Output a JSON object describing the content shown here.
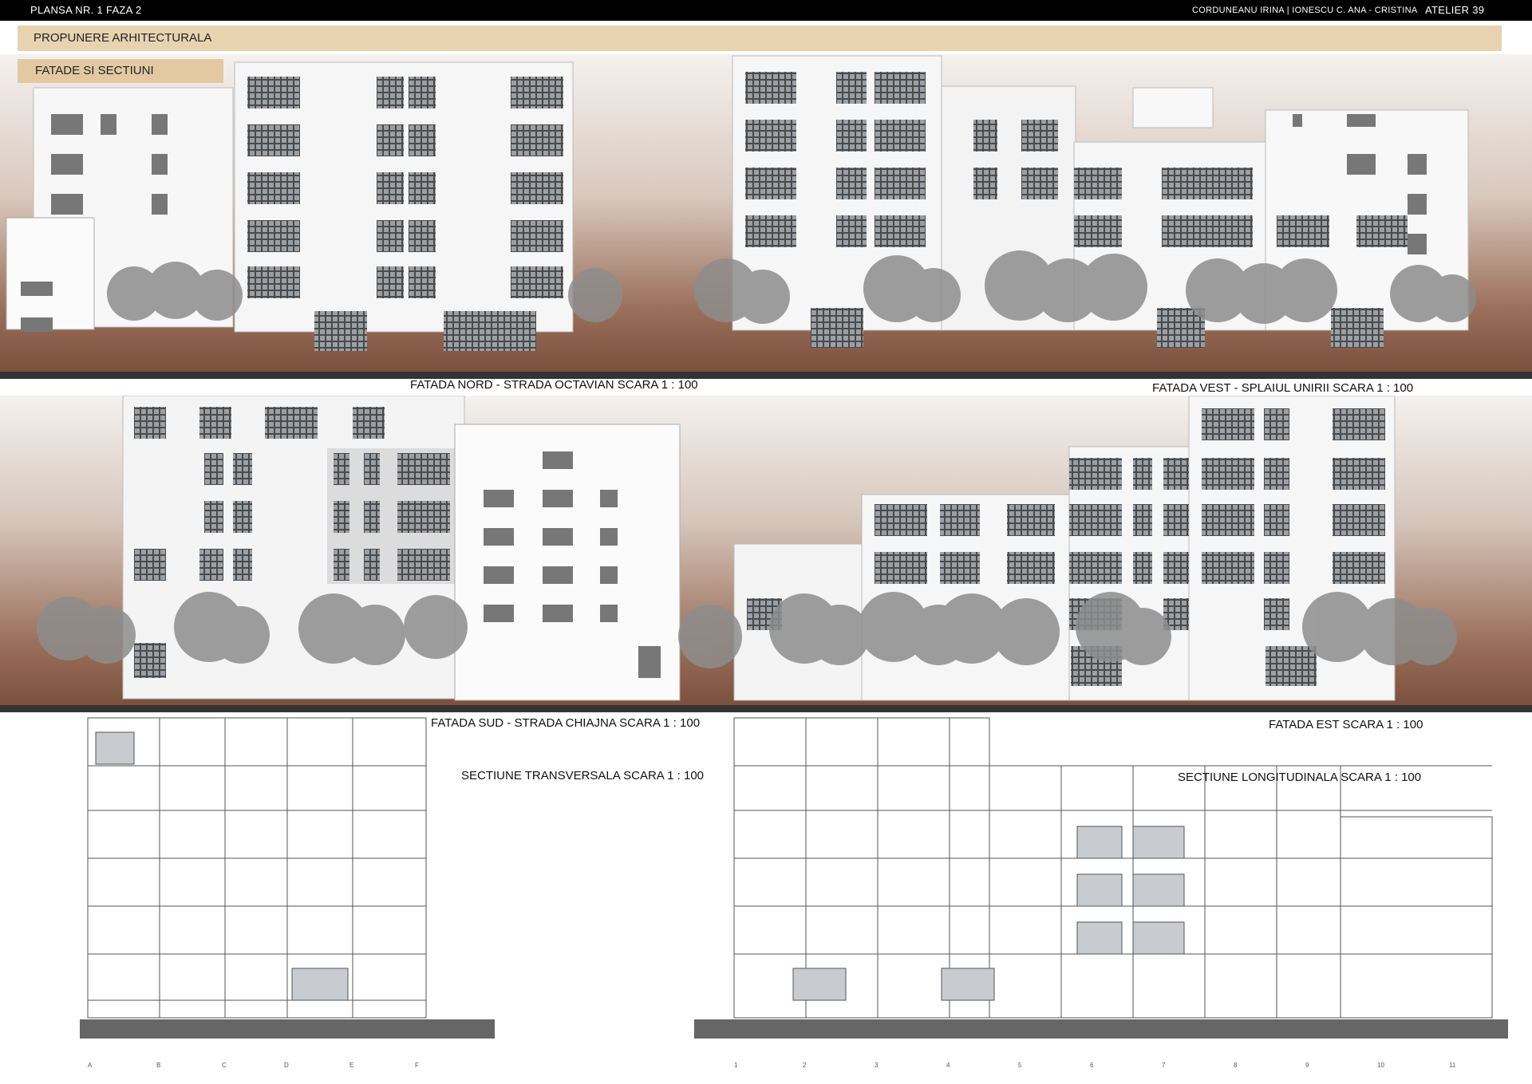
{
  "header": {
    "sheet_label": "PLANSA NR. 1 FAZA 2",
    "authors": "CORDUNEANU IRINA | IONESCU C. ANA - CRISTINA",
    "studio": "ATELIER 39"
  },
  "banner": {
    "title": "PROPUNERE ARHITECTURALA",
    "subtitle": "FATADE SI SECTIUNI"
  },
  "captions": {
    "north": "FATADA NORD - STRADA OCTAVIAN SCARA 1 : 100",
    "west": "FATADA VEST - SPLAIUL UNIRII SCARA 1 : 100",
    "south": "FATADA SUD - STRADA CHIAJNA SCARA 1 : 100",
    "east": "FATADA EST SCARA 1 : 100",
    "transversal": "SECTIUNE TRANSVERSALA SCARA 1 : 100",
    "longitudinal": "SECTIUNE LONGITUDINALA SCARA 1 : 100"
  },
  "grid_axes": {
    "transversal": [
      "A",
      "B",
      "C",
      "D",
      "E",
      "F"
    ],
    "longitudinal": [
      "1",
      "2",
      "3",
      "4",
      "5",
      "6",
      "7",
      "8",
      "9",
      "10",
      "11"
    ]
  },
  "colors": {
    "header_bg": "#000000",
    "banner": "#e8d3b0",
    "subtitle_band": "#e2c9a2",
    "backdrop_warm": "#7a4f3c",
    "ground": "#333333"
  }
}
